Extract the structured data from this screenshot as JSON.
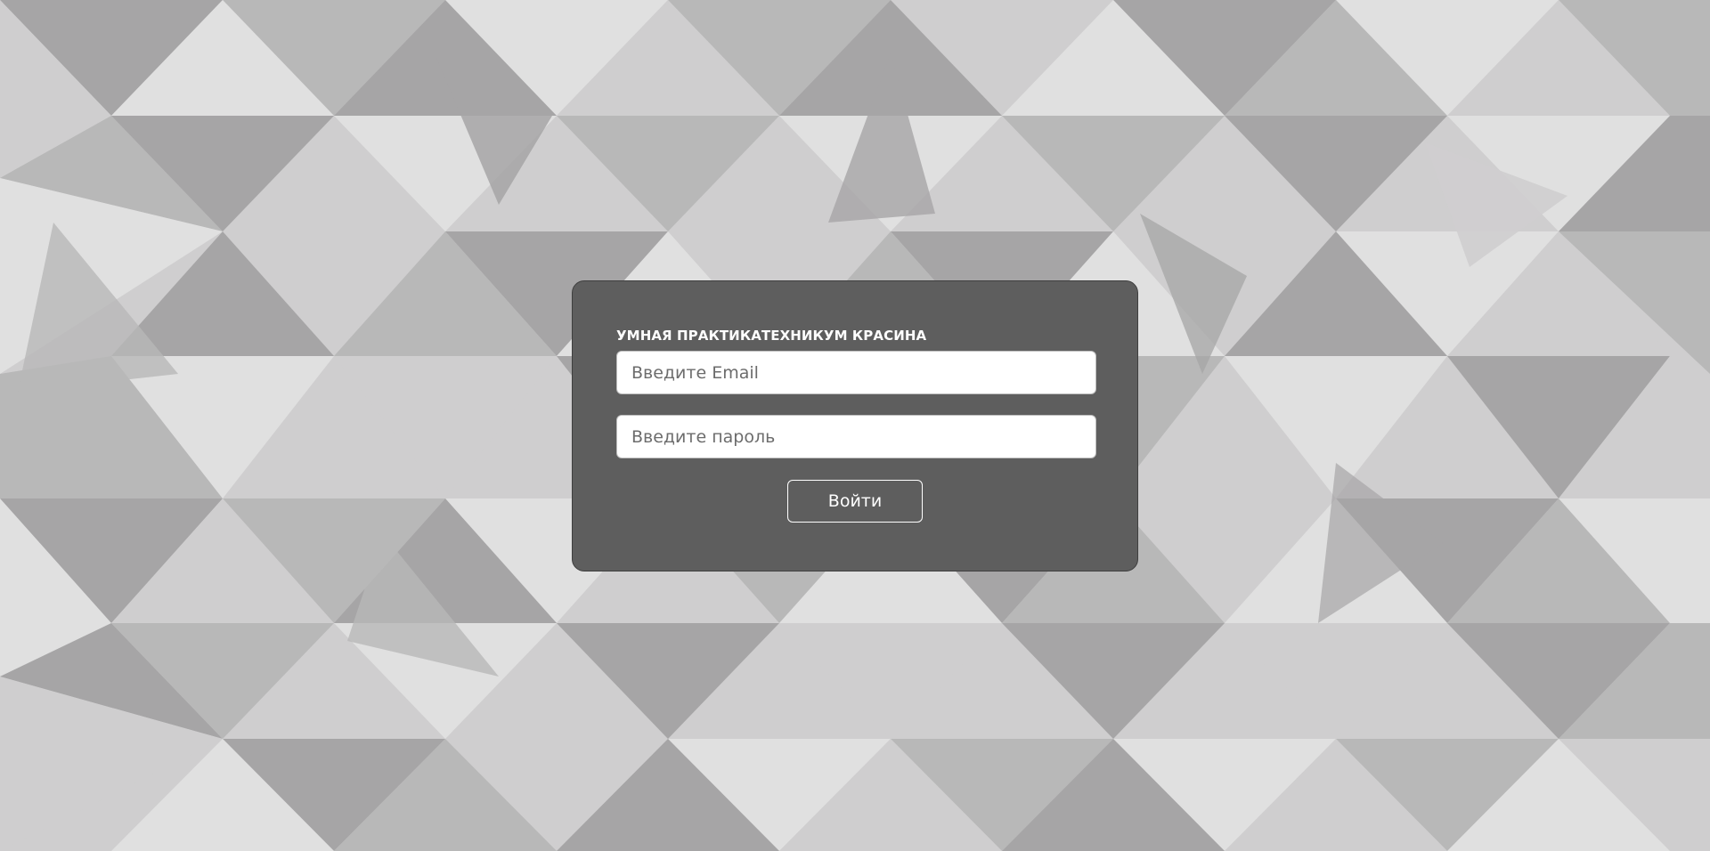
{
  "colors": {
    "card_background": "#5e5e5e",
    "text_light": "#ffffff",
    "pattern_shades": [
      "#a6a5a6",
      "#b8b8b8",
      "#cfcecf",
      "#e0e0e0"
    ]
  },
  "login": {
    "title": "УМНАЯ ПРАКТИКАТЕХНИКУМ КРАСИНА",
    "email": {
      "value": "",
      "placeholder": "Введите Email"
    },
    "password": {
      "value": "",
      "placeholder": "Введите пароль"
    },
    "submit_label": "Войти"
  }
}
